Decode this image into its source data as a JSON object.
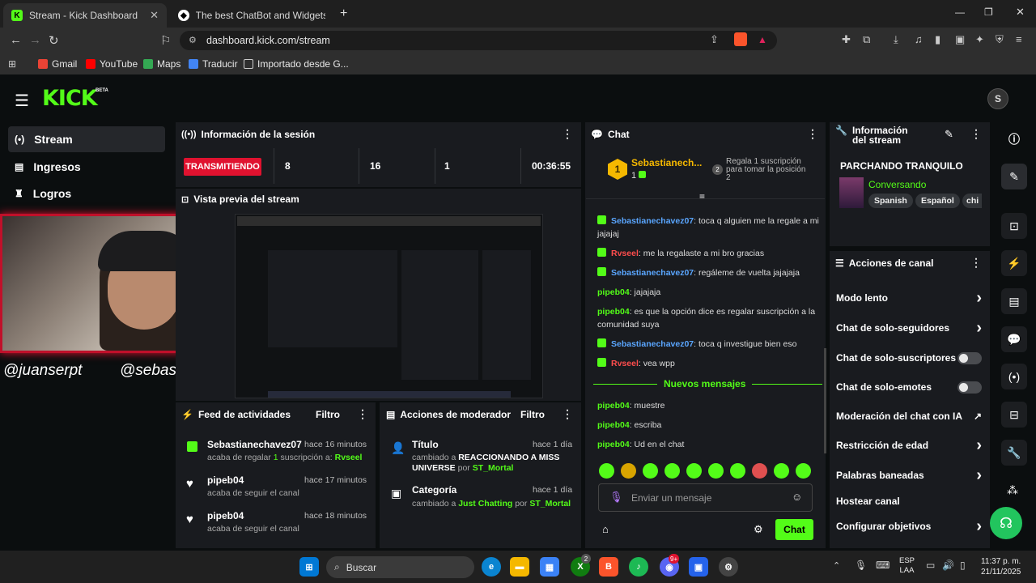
{
  "browser": {
    "tabs": [
      {
        "label": "Stream - Kick Dashboard",
        "close": "✕"
      },
      {
        "label": "The best ChatBot and Widgets for Ki"
      }
    ],
    "new_tab": "+",
    "url": "dashboard.kick.com/stream",
    "bookmarks": [
      "Gmail",
      "YouTube",
      "Maps",
      "Traducir",
      "Importado desde G..."
    ]
  },
  "app": {
    "logo": "KICK",
    "logo_badge": "BETA",
    "sidebar": [
      {
        "label": "Stream",
        "icon": "broadcast-icon"
      },
      {
        "label": "Ingresos",
        "icon": "chart-icon"
      },
      {
        "label": "Logros",
        "icon": "trophy-icon"
      }
    ]
  },
  "session": {
    "title": "Información de la sesión",
    "status": "TRANSMITIENDO",
    "stats": [
      "8",
      "16",
      "1"
    ],
    "duration": "00:36:55"
  },
  "preview": {
    "title": "Vista previa del stream",
    "handle1": "@juanserpt",
    "handle2": "@sebastuqui"
  },
  "feed": {
    "title": "Feed de actividades",
    "filter": "Filtro",
    "items": [
      {
        "name": "Sebastianechavez07",
        "time": "hace 16 minutos",
        "text_pre": "acaba de regalar ",
        "count": "1",
        "text_mid": " suscripción a: ",
        "target": "Rvseel"
      },
      {
        "name": "pipeb04",
        "time": "hace 17 minutos",
        "text": "acaba de seguir el canal"
      },
      {
        "name": "pipeb04",
        "time": "hace 18 minutos",
        "text": "acaba de seguir el canal"
      }
    ]
  },
  "mod": {
    "title": "Acciones de moderador",
    "filter": "Filtro",
    "items": [
      {
        "label": "Título",
        "time": "hace 1 día",
        "pre": "cambiado a ",
        "value": "REACCIONANDO A MISS UNIVERSE",
        "by": " por ",
        "user": "ST_Mortal"
      },
      {
        "label": "Categoría",
        "time": "hace 1 día",
        "pre": "cambiado a ",
        "value": "Just Chatting",
        "by": " por ",
        "user": "ST_Mortal"
      }
    ]
  },
  "chat": {
    "title": "Chat",
    "top_gifter": {
      "rank": "1",
      "name": "Sebastianech...",
      "count": "1",
      "reward": "Regala 1 suscripción para tomar la posición 2",
      "reward_rank": "2"
    },
    "messages": [
      {
        "user": "Sebastianechavez07",
        "sep": ":",
        "text": " toca q alguien me la regale a mi jajajaj",
        "color": "blue",
        "badge": true
      },
      {
        "user": "Rvseel",
        "sep": ":",
        "text": " me la regalaste a mi bro gracias",
        "color": "red",
        "badge": true
      },
      {
        "user": "Sebastianechavez07",
        "sep": ":",
        "text": " regáleme de vuelta jajajaja",
        "color": "blue",
        "badge": true
      },
      {
        "user": "pipeb04",
        "sep": ":",
        "text": " jajajaja",
        "color": "green",
        "badge": false
      },
      {
        "user": "pipeb04",
        "sep": ":",
        "text": " es que la opción dice es regalar suscripción a la comunidad suya",
        "color": "green",
        "badge": false
      },
      {
        "user": "Sebastianechavez07",
        "sep": ":",
        "text": " toca q investigue bien eso",
        "color": "blue",
        "badge": true
      },
      {
        "user": "Rvseel",
        "sep": ":",
        "text": " vea wpp",
        "color": "red",
        "badge": true
      }
    ],
    "new_messages_label": "Nuevos mensajes",
    "new_messages": [
      {
        "user": "pipeb04",
        "sep": ":",
        "text": " muestre"
      },
      {
        "user": "pipeb04",
        "sep": ":",
        "text": " escriba"
      },
      {
        "user": "pipeb04",
        "sep": ":",
        "text": " Ud en el chat"
      }
    ],
    "placeholder": "Enviar un mensaje",
    "send": "Chat"
  },
  "stream_info": {
    "title": "Información del stream",
    "stream_title": "PARCHANDO TRANQUILO",
    "category": "Conversando",
    "tags": [
      "Spanish",
      "Español",
      "chi"
    ]
  },
  "channel_actions": {
    "title": "Acciones de canal",
    "items": [
      {
        "label": "Modo lento",
        "control": "arrow"
      },
      {
        "label": "Chat de solo-seguidores",
        "control": "arrow"
      },
      {
        "label": "Chat de solo-suscriptores",
        "control": "toggle"
      },
      {
        "label": "Chat de solo-emotes",
        "control": "toggle"
      },
      {
        "label": "Moderación del chat con IA",
        "control": "external"
      },
      {
        "label": "Restricción de edad",
        "control": "arrow"
      },
      {
        "label": "Palabras baneadas",
        "control": "arrow"
      },
      {
        "label": "Hostear canal",
        "control": "none"
      },
      {
        "label": "Configurar objetivos",
        "control": "arrow"
      }
    ]
  },
  "taskbar": {
    "search": "Buscar",
    "lang": "ESP",
    "lang2": "LAA",
    "time": "11:37 p. m.",
    "date": "21/11/2025",
    "badge_xbox": "2",
    "badge_discord": "9+"
  },
  "colors": {
    "accent": "#53fc18",
    "live": "#e0122f",
    "panel": "#191b1f"
  }
}
